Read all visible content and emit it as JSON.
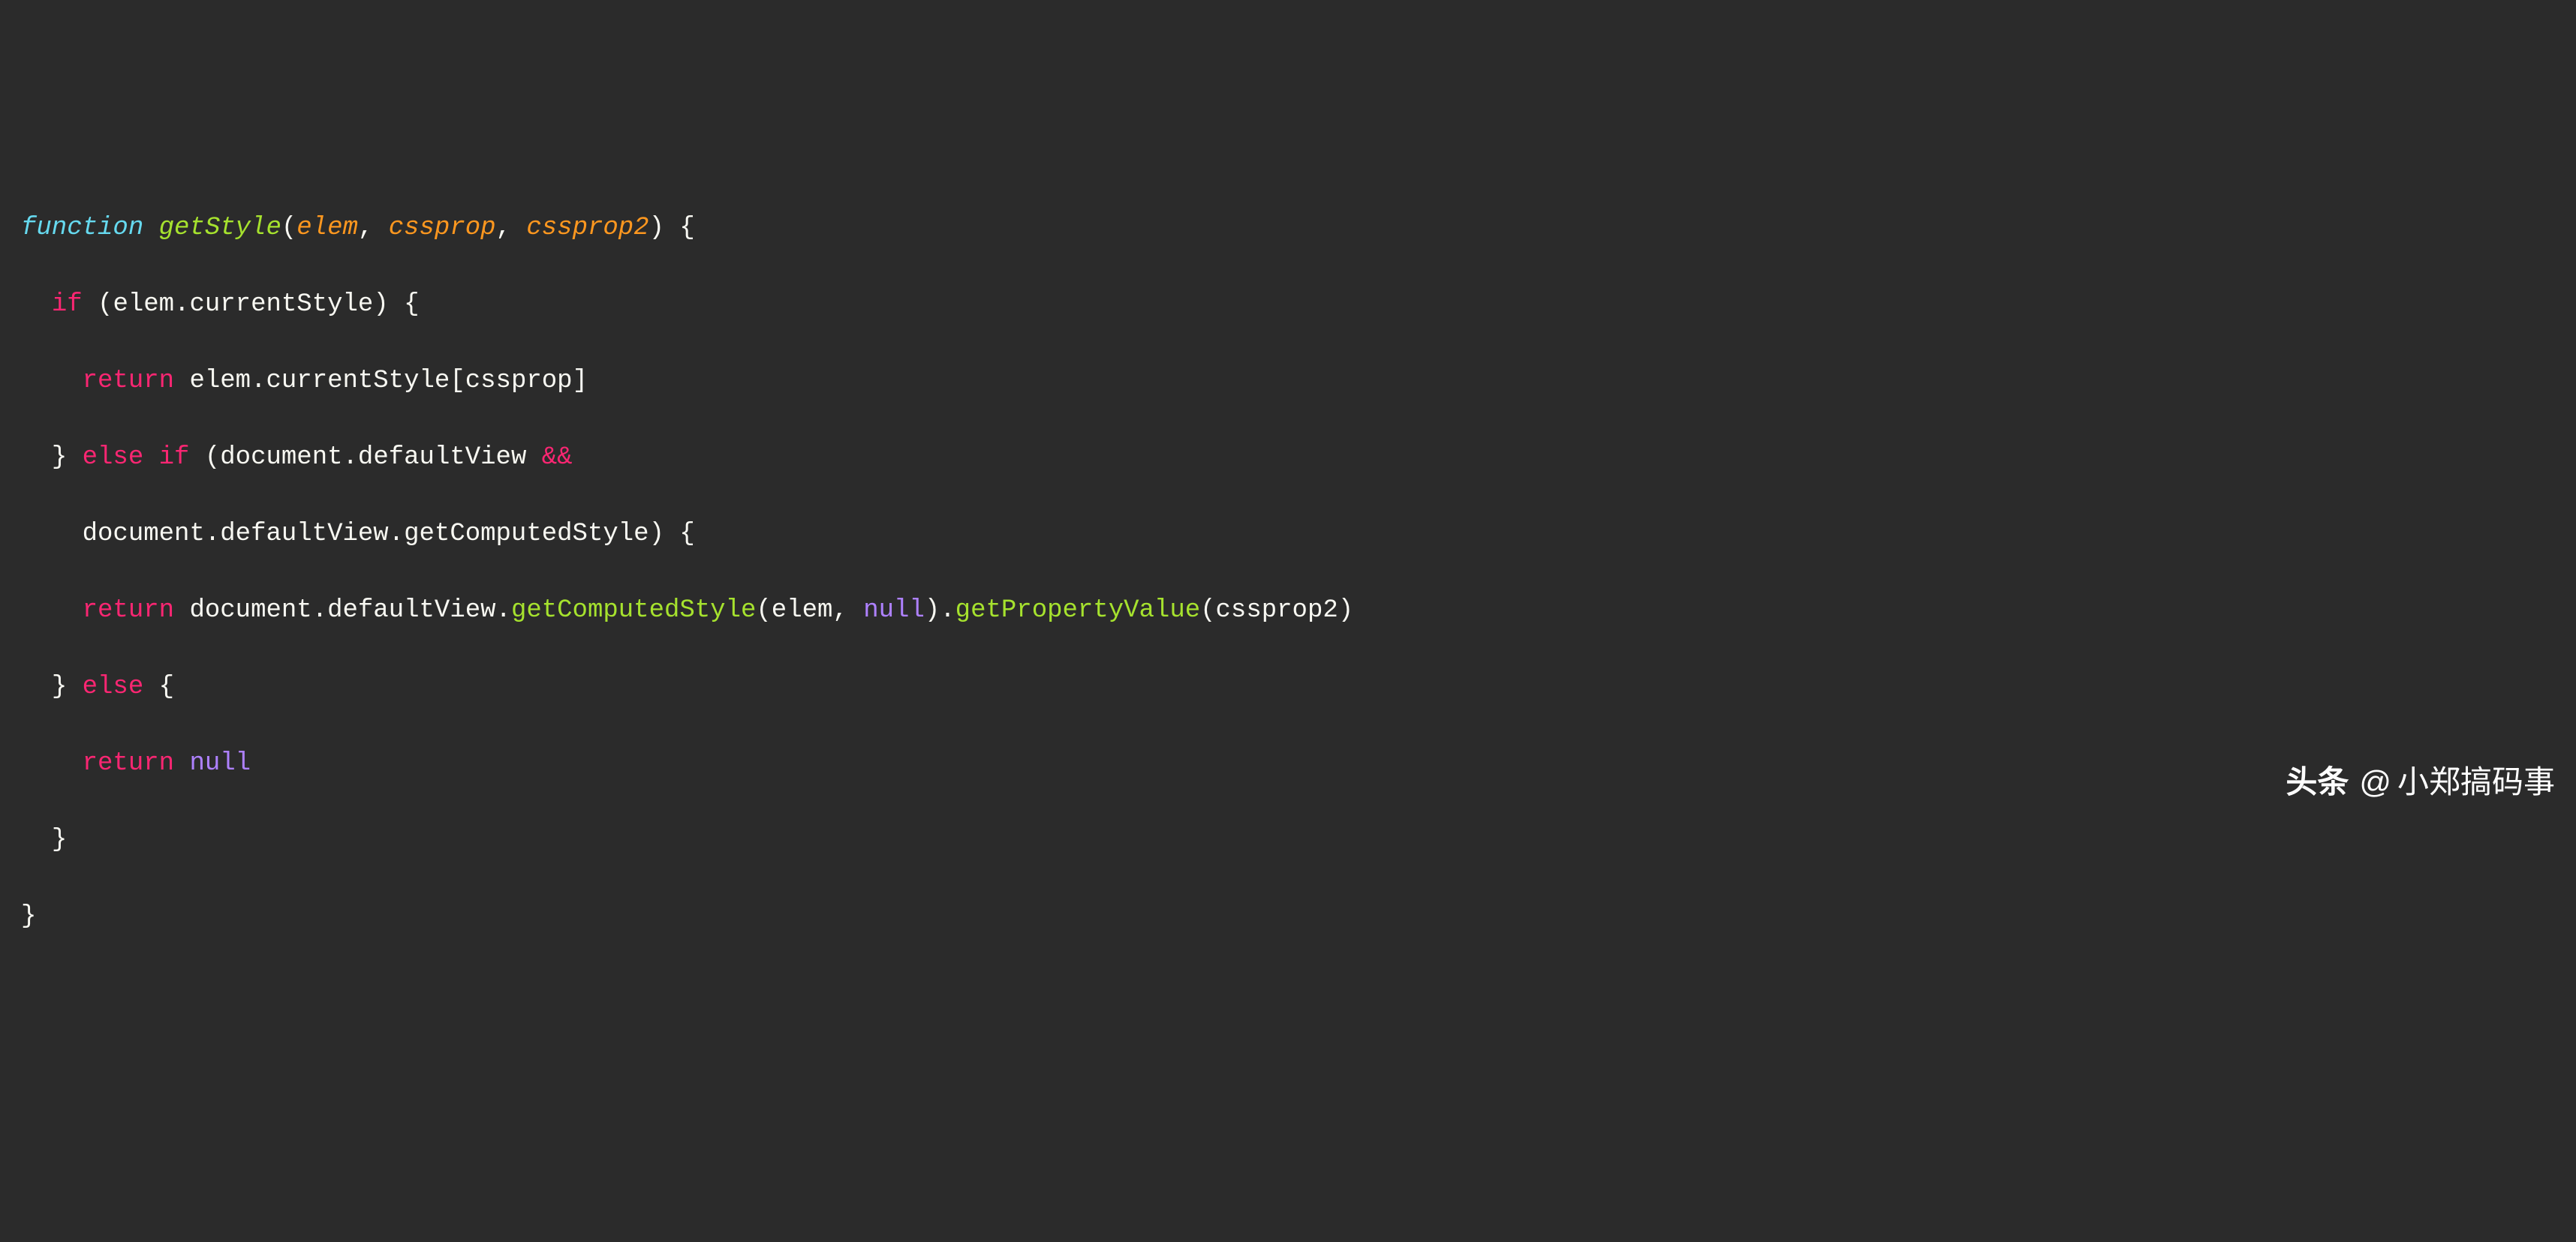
{
  "code": {
    "language": "javascript",
    "tokens": {
      "kw_function": "function",
      "fn_name": "getStyle",
      "param1": "elem",
      "param2": "cssprop",
      "param3": "cssprop2",
      "kw_if": "if",
      "kw_else": "else",
      "kw_return": "return",
      "kw_null": "null",
      "op_and": "&&",
      "ident_elem": "elem",
      "ident_currentStyle": "currentStyle",
      "ident_cssprop": "cssprop",
      "ident_cssprop2": "cssprop2",
      "ident_document": "document",
      "ident_defaultView": "defaultView",
      "method_getComputedStyle": "getComputedStyle",
      "method_getPropertyValue": "getPropertyValue",
      "punct_open_paren": "(",
      "punct_close_paren": ")",
      "punct_open_brace": "{",
      "punct_close_brace": "}",
      "punct_open_bracket": "[",
      "punct_close_bracket": "]",
      "punct_comma": ",",
      "punct_dot": "."
    }
  },
  "watermark": {
    "brand": "头条",
    "at": "@",
    "author": "小郑搞码事"
  }
}
